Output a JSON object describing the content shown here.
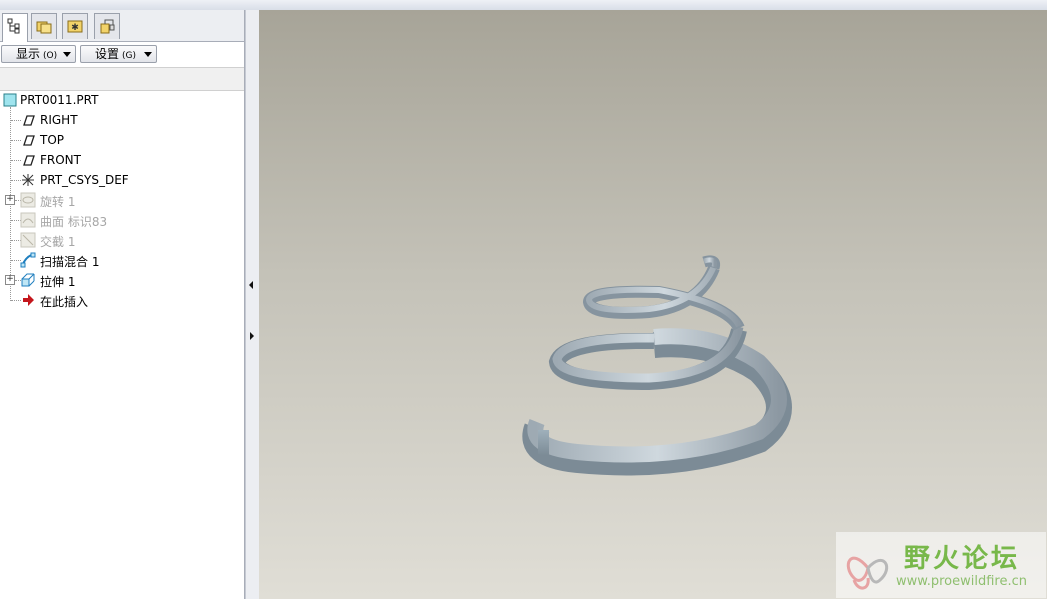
{
  "nav_tabs": [
    {
      "name": "model-tree-tab",
      "icon": "model-tree-icon"
    },
    {
      "name": "folder-browser-tab",
      "icon": "folder-browser-icon"
    },
    {
      "name": "favorites-tab",
      "icon": "favorites-icon"
    },
    {
      "name": "connections-tab",
      "icon": "connections-icon"
    }
  ],
  "menus": {
    "show_label": "显示",
    "show_shortcut": "(O)",
    "settings_label": "设置",
    "settings_shortcut": "(G)"
  },
  "tree": {
    "root": {
      "label": "PRT0011.PRT",
      "icon": "part-icon"
    },
    "items": [
      {
        "label": "RIGHT",
        "icon": "datum-plane-icon",
        "dim": false,
        "expandable": false
      },
      {
        "label": "TOP",
        "icon": "datum-plane-icon",
        "dim": false,
        "expandable": false
      },
      {
        "label": "FRONT",
        "icon": "datum-plane-icon",
        "dim": false,
        "expandable": false
      },
      {
        "label": "PRT_CSYS_DEF",
        "icon": "coordinate-system-icon",
        "dim": false,
        "expandable": false
      },
      {
        "label": "旋转 1",
        "icon": "revolve-icon",
        "dim": true,
        "expandable": true
      },
      {
        "label": "曲面 标识83",
        "icon": "surface-icon",
        "dim": true,
        "expandable": false
      },
      {
        "label": "交截 1",
        "icon": "intersect-icon",
        "dim": true,
        "expandable": false
      },
      {
        "label": "扫描混合 1",
        "icon": "swept-blend-icon",
        "dim": false,
        "expandable": false
      },
      {
        "label": "拉伸 1",
        "icon": "extrude-icon",
        "dim": false,
        "expandable": true
      },
      {
        "label": "在此插入",
        "icon": "insert-here-arrow-icon",
        "dim": false,
        "expandable": false
      }
    ]
  },
  "watermark": {
    "title": "野火论坛",
    "url": "www.proewildfire.cn",
    "icon": "butterfly-logo-icon"
  },
  "colors": {
    "spring": "#a9b9c4",
    "dim_text": "#a6a6a6",
    "background_top": "#a7a498",
    "background_bottom": "#e0ded6",
    "watermark_green": "#78b84a"
  }
}
